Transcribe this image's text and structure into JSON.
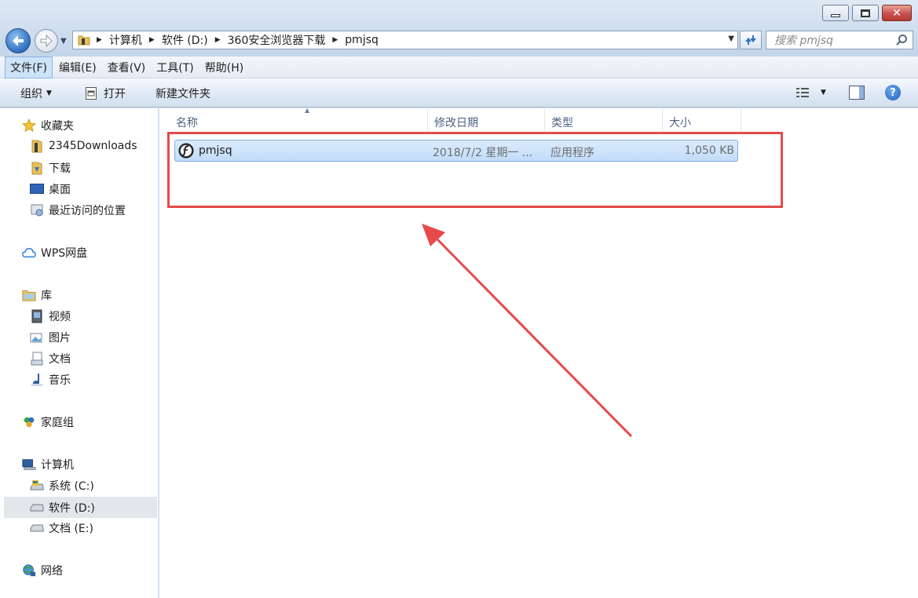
{
  "window": {
    "minimize_icon": "minimize-icon",
    "maximize_icon": "maximize-icon",
    "close_glyph": "✕"
  },
  "address_bar": {
    "breadcrumbs": [
      "计算机",
      "软件 (D:)",
      "360安全浏览器下载",
      "pmjsq"
    ]
  },
  "search": {
    "placeholder": "搜索 pmjsq"
  },
  "menu": {
    "items": [
      {
        "label": "文件(F)",
        "active": true
      },
      {
        "label": "编辑(E)"
      },
      {
        "label": "查看(V)"
      },
      {
        "label": "工具(T)"
      },
      {
        "label": "帮助(H)"
      }
    ]
  },
  "toolbar": {
    "organize": "组织",
    "open": "打开",
    "new_folder": "新建文件夹",
    "help": "?"
  },
  "nav": {
    "favorites": {
      "label": "收藏夹",
      "items": [
        "2345Downloads",
        "下载",
        "桌面",
        "最近访问的位置"
      ]
    },
    "wps": "WPS网盘",
    "libraries": {
      "label": "库",
      "items": [
        "视频",
        "图片",
        "文档",
        "音乐"
      ]
    },
    "homegroup": "家庭组",
    "computer": {
      "label": "计算机",
      "items": [
        "系统 (C:)",
        "软件 (D:)",
        "文档 (E:)"
      ],
      "selected": "软件 (D:)"
    },
    "network": "网络"
  },
  "columns": {
    "name": "名称",
    "modified": "修改日期",
    "type": "类型",
    "size": "大小"
  },
  "files": [
    {
      "name": "pmjsq",
      "modified": "2018/7/2 星期一 ...",
      "type": "应用程序",
      "size": "1,050 KB",
      "selected": true
    }
  ],
  "annotation_color": "#e64a4a"
}
